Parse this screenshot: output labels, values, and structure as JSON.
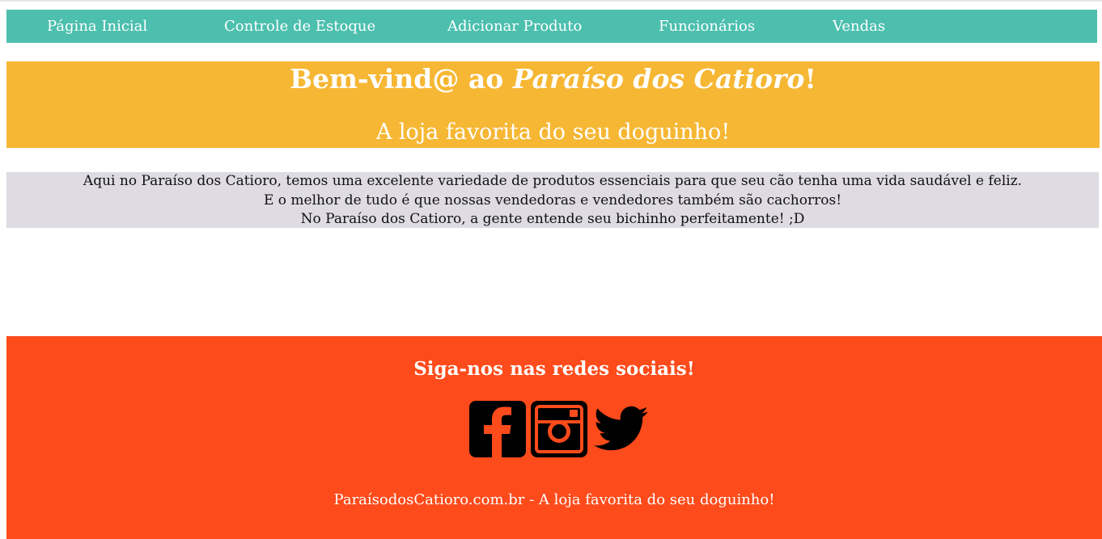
{
  "nav": {
    "items": [
      {
        "label": "Página Inicial"
      },
      {
        "label": "Controle de Estoque"
      },
      {
        "label": "Adicionar Produto"
      },
      {
        "label": "Funcionários"
      },
      {
        "label": "Vendas"
      }
    ]
  },
  "hero": {
    "title_prefix": "Bem-vind@ ao ",
    "title_brand": "Paraíso dos Catioro",
    "title_suffix": "!",
    "subtitle": "A loja favorita do seu doguinho!"
  },
  "about": {
    "lines": [
      "Aqui no Paraíso dos Catioro, temos uma excelente variedade de produtos essenciais para que seu cão tenha uma vida saudável e feliz.",
      "E o melhor de tudo é que nossas vendedoras e vendedores também são cachorros!",
      "No Paraíso dos Catioro, a gente entende seu bichinho perfeitamente! ;D"
    ]
  },
  "footer": {
    "heading": "Siga-nos nas redes sociais!",
    "social_icons": [
      "facebook-icon",
      "instagram-icon",
      "twitter-icon"
    ],
    "note": "ParaísodosCatioro.com.br - A loja favorita do seu doguinho!"
  },
  "colors": {
    "nav": "#4cbfae",
    "hero": "#f6b734",
    "about": "#dedbe2",
    "footer": "#fe4b1b"
  }
}
